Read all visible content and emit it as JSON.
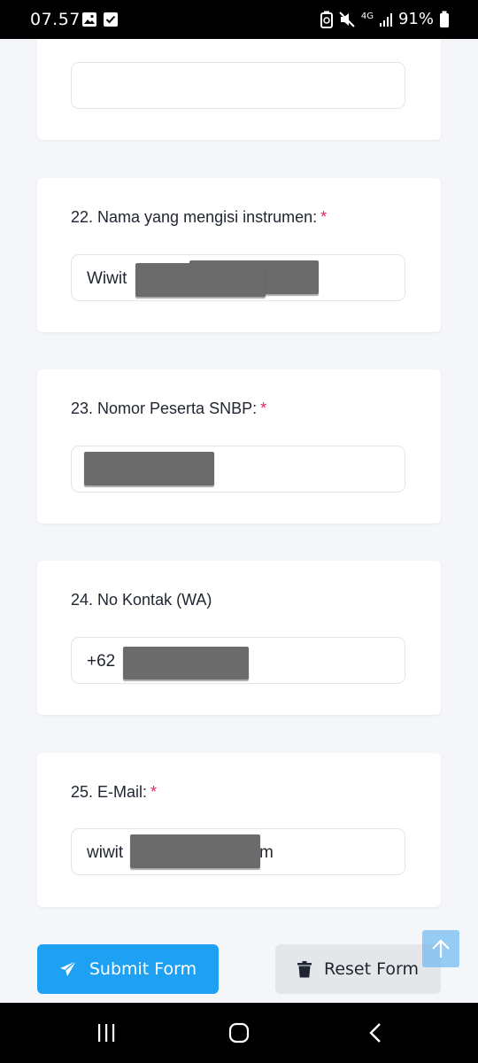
{
  "status_bar": {
    "time": "07.57",
    "network": "4G",
    "battery": "91%",
    "icons": [
      "gallery-icon",
      "check-icon",
      "battery-saver-icon",
      "mute-icon",
      "signal-icon",
      "battery-icon"
    ]
  },
  "questions": [
    {
      "number_label": "22. Nama yang mengisi instrumen:",
      "required": "*",
      "value": "Wiwit"
    },
    {
      "number_label": "23. Nomor Peserta SNBP:",
      "required": "*",
      "value": ""
    },
    {
      "number_label": "24. No Kontak (WA)",
      "required": "",
      "value": "+62"
    },
    {
      "number_label": "25. E-Mail:",
      "required": "*",
      "value_prefix": "wiwit",
      "value_suffix": "m"
    }
  ],
  "buttons": {
    "submit_label": "Submit Form",
    "reset_label": "Reset Form"
  },
  "colors": {
    "accent": "#1ea1f2",
    "required": "#e0245e",
    "background": "#f4f6f9"
  }
}
